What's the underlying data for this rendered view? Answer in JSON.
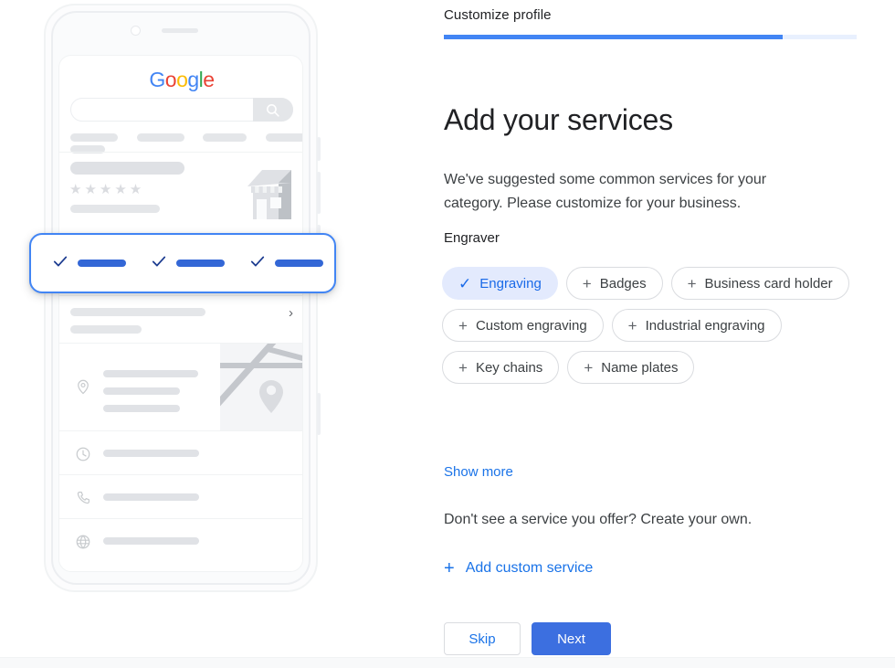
{
  "step": {
    "label": "Customize profile",
    "progress_percent": 82,
    "fill_color": "#4285f4",
    "track_color": "#e8f0fe"
  },
  "main": {
    "title": "Add your services",
    "description": "We've suggested some common services for your category. Please customize for your business.",
    "category_label": "Engraver",
    "chips": [
      {
        "label": "Engraving",
        "icon": "check-icon",
        "glyph": "✓",
        "selected": true
      },
      {
        "label": "Badges",
        "icon": "plus-icon",
        "glyph": "+",
        "selected": false
      },
      {
        "label": "Business card holder",
        "icon": "plus-icon",
        "glyph": "+",
        "selected": false
      },
      {
        "label": "Custom engraving",
        "icon": "plus-icon",
        "glyph": "+",
        "selected": false
      },
      {
        "label": "Industrial engraving",
        "icon": "plus-icon",
        "glyph": "+",
        "selected": false
      },
      {
        "label": "Key chains",
        "icon": "plus-icon",
        "glyph": "+",
        "selected": false
      },
      {
        "label": "Name plates",
        "icon": "plus-icon",
        "glyph": "+",
        "selected": false
      }
    ],
    "show_more": "Show more",
    "no_service_text": "Don't see a service you offer? Create your own.",
    "add_custom": {
      "label": "Add custom service",
      "glyph": "+"
    }
  },
  "actions": {
    "skip_label": "Skip",
    "next_label": "Next",
    "next_color": "#3c6fe0",
    "link_color": "#1a73e8"
  },
  "illustration": {
    "type": "phone-mockup",
    "google_logo": {
      "letters": [
        "G",
        "o",
        "o",
        "g",
        "l",
        "e"
      ]
    },
    "search_icon": "magnifier-icon",
    "stars": "★★★★★",
    "chevron": "›",
    "rows": [
      {
        "icon": "location-pin-icon",
        "has_map": true
      },
      {
        "icon": "clock-icon",
        "has_map": false
      },
      {
        "icon": "phone-icon",
        "has_map": false
      },
      {
        "icon": "globe-icon",
        "has_map": false
      }
    ],
    "highlight_card": {
      "accent_color": "#4285f4",
      "items": [
        {
          "icon": "check-icon"
        },
        {
          "icon": "check-icon"
        },
        {
          "icon": "check-icon"
        }
      ]
    }
  }
}
